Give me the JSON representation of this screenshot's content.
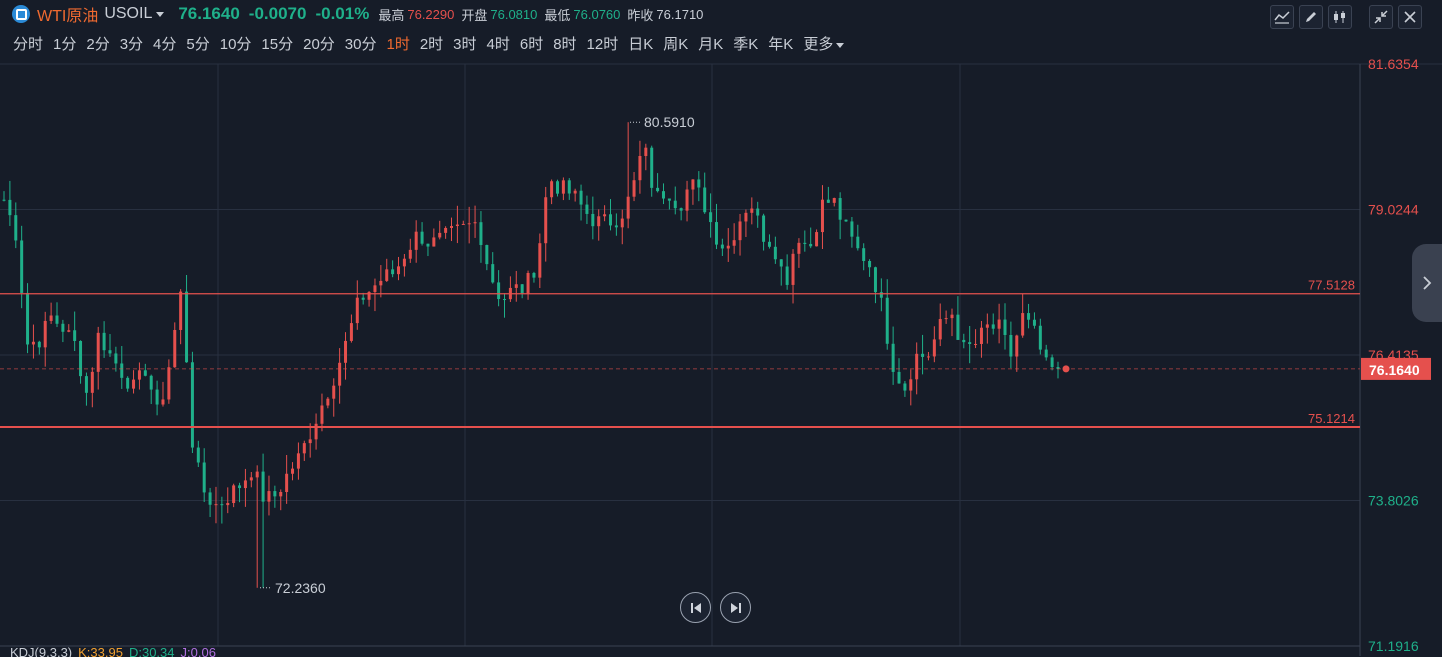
{
  "header": {
    "symbol_name": "WTI原油",
    "symbol_code": "USOIL",
    "price": "76.1640",
    "change": "-0.0070",
    "change_pct": "-0.01%",
    "high_label": "最高",
    "high_value": "76.2290",
    "open_label": "开盘",
    "open_value": "76.0810",
    "low_label": "最低",
    "low_value": "76.0760",
    "prev_close_label": "昨收",
    "prev_close_value": "76.1710"
  },
  "periods": [
    "分时",
    "1分",
    "2分",
    "3分",
    "4分",
    "5分",
    "10分",
    "15分",
    "20分",
    "30分",
    "1时",
    "2时",
    "3时",
    "4时",
    "6时",
    "8时",
    "12时",
    "日K",
    "周K",
    "月K",
    "季K",
    "年K"
  ],
  "active_period": "1时",
  "more_label": "更多",
  "toolbar_icons": [
    "line-tool-icon",
    "pen-icon",
    "candle-style-icon",
    "collapse-icon",
    "close-icon"
  ],
  "colors": {
    "up": "#e5504d",
    "down": "#1fb08a",
    "bg": "#161c28",
    "grid": "#283040",
    "accent": "#f06a30"
  },
  "chart_data": {
    "type": "candlestick",
    "y_axis_ticks": [
      "81.6354",
      "79.0244",
      "76.4135",
      "73.8026",
      "71.1916"
    ],
    "ylim": [
      71.1916,
      81.6354
    ],
    "current_price": "76.1640",
    "annotations": {
      "max_label": "80.5910",
      "min_label": "72.2360"
    },
    "horizontal_lines": [
      {
        "label": "77.5128",
        "value": 77.5128
      },
      {
        "label": "75.1214",
        "value": 75.1214
      }
    ],
    "close_path": [
      79.2,
      78.6,
      76.6,
      76.7,
      77.1,
      76.9,
      76.6,
      75.7,
      76.8,
      76.4,
      76.1,
      75.8,
      76.2,
      75.3,
      76.3,
      77.6,
      74.6,
      73.9,
      73.7,
      73.9,
      74.1,
      74.4,
      73.8,
      73.9,
      74.3,
      74.6,
      75.1,
      75.6,
      76.1,
      76.7,
      77.4,
      77.6,
      77.8,
      77.9,
      78.3,
      78.6,
      78.4,
      78.5,
      78.6,
      78.7,
      78.8,
      77.9,
      77.4,
      77.6,
      77.6,
      78.1,
      79.6,
      79.4,
      79.3,
      79.0,
      78.8,
      78.8,
      78.9,
      79.3,
      80.2,
      79.2,
      79.4,
      79.1,
      79.5,
      79.2,
      78.6,
      78.3,
      78.8,
      79.2,
      78.6,
      78.4,
      77.7,
      78.6,
      78.3,
      79.1,
      79.2,
      78.7,
      78.3,
      78.1,
      77.4,
      76.3,
      75.8,
      76.4,
      76.4,
      76.9,
      77.2,
      76.5,
      76.6,
      76.9,
      76.9,
      76.4,
      77.1,
      76.8,
      76.2,
      76.1
    ],
    "candle_count": 180
  },
  "kdj": {
    "name": "KDJ(9,3,3)",
    "k": "K:33.95",
    "d": "D:30.34",
    "j": "J:0.06"
  }
}
